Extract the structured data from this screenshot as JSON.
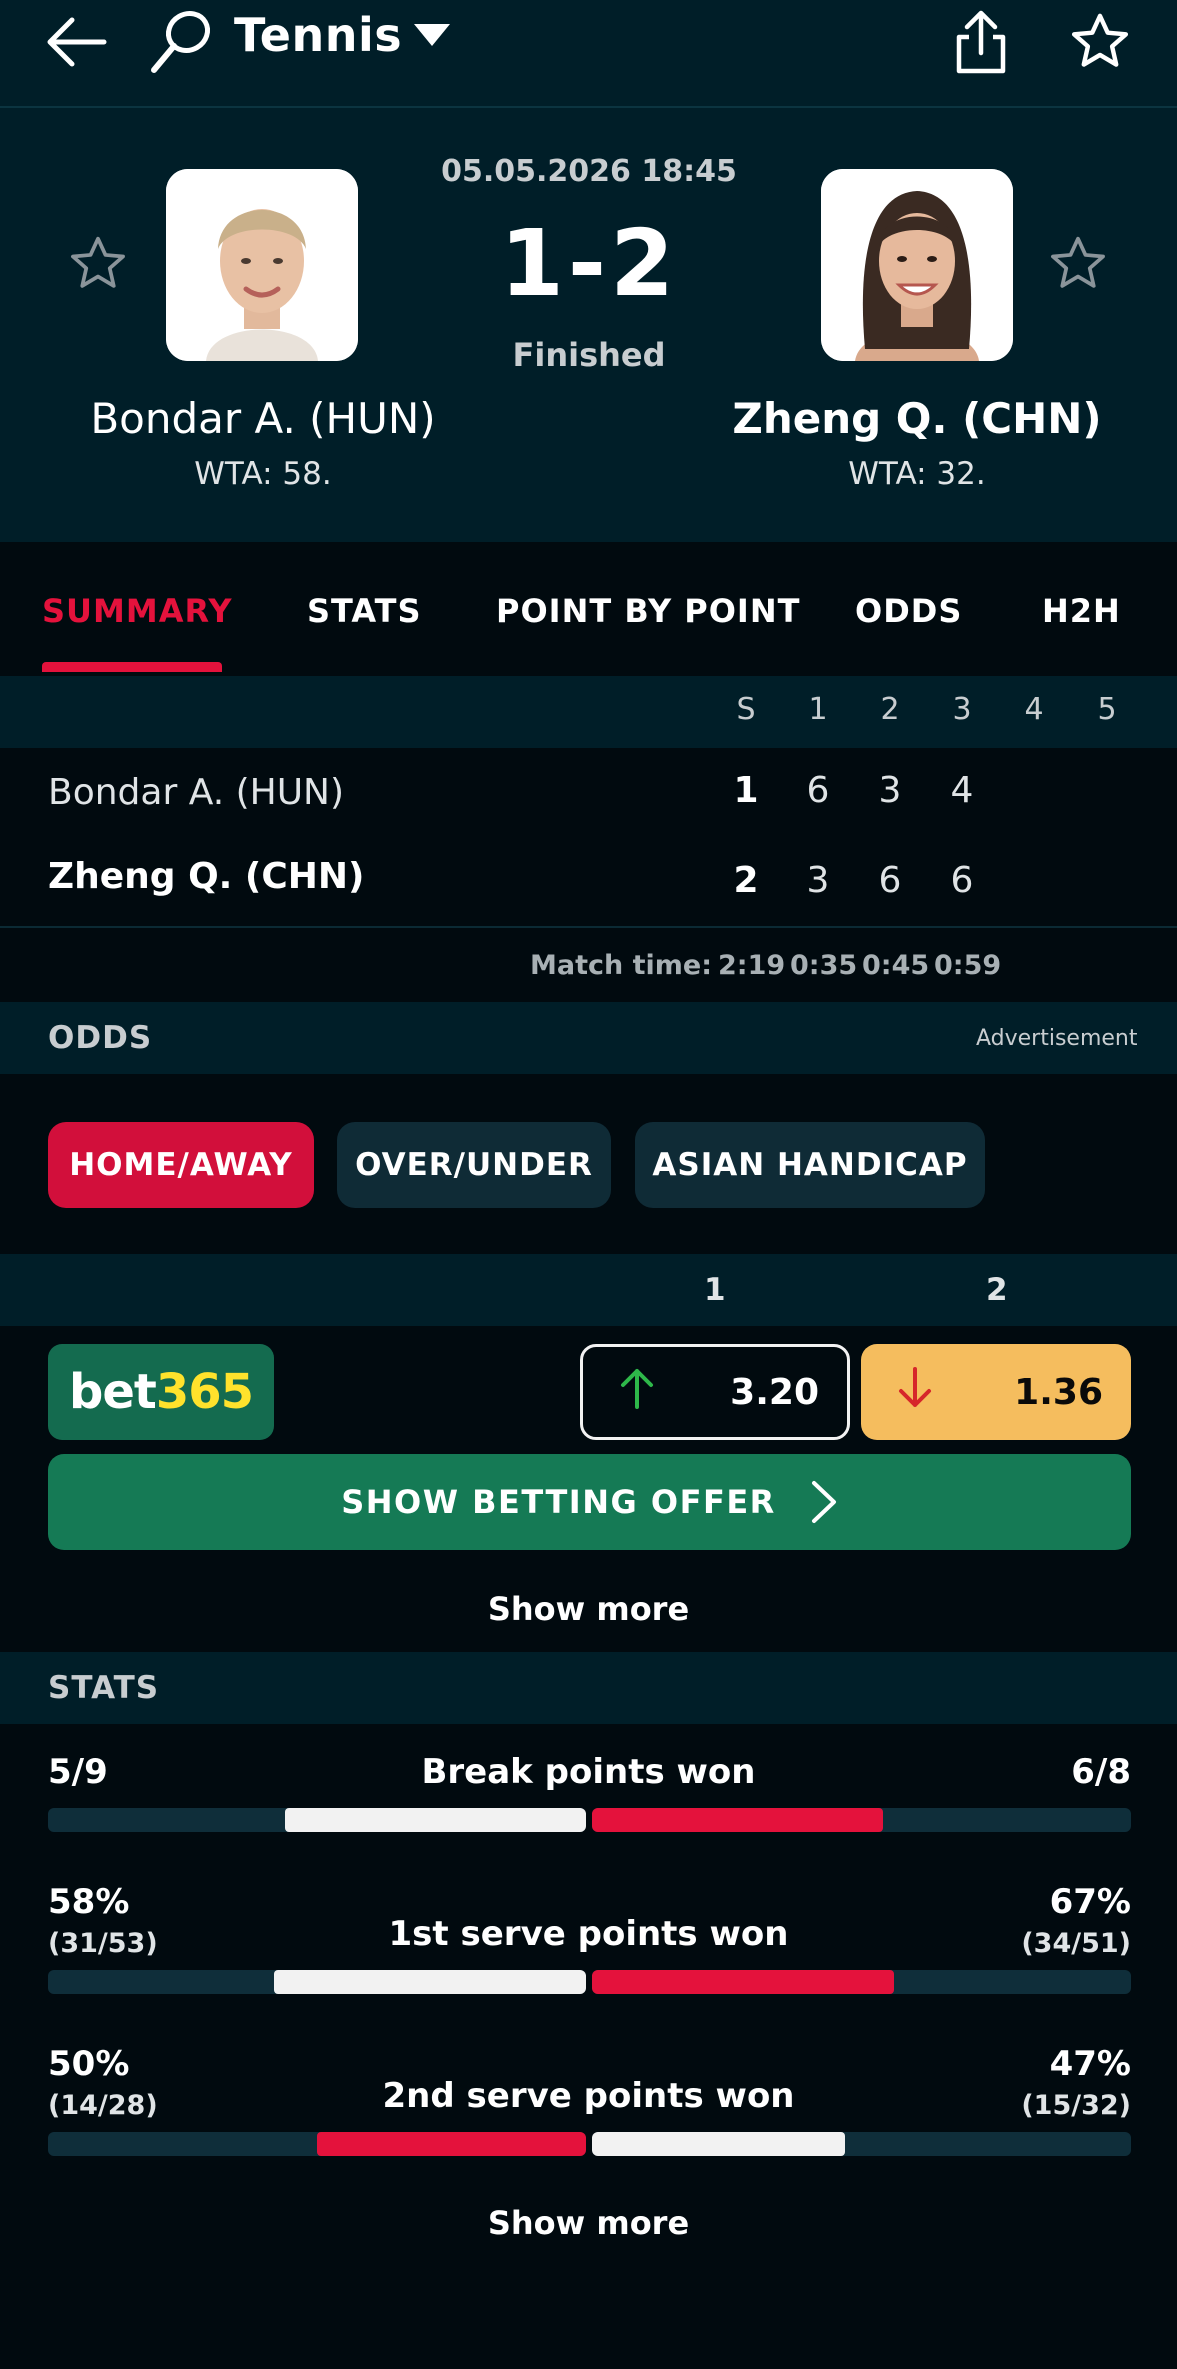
{
  "topbar": {
    "sport": "Tennis",
    "icons": [
      "back-arrow-icon",
      "tennis-racket-icon",
      "chevron-down-icon",
      "share-icon",
      "star-icon"
    ]
  },
  "match": {
    "datetime": "05.05.2026 18:45",
    "score": "1-2",
    "status": "Finished",
    "home": {
      "name": "Bondar A. (HUN)",
      "rank": "WTA: 58."
    },
    "away": {
      "name": "Zheng Q. (CHN)",
      "rank": "WTA: 32."
    }
  },
  "tabs": [
    {
      "label": "SUMMARY",
      "active": true
    },
    {
      "label": "STATS",
      "active": false
    },
    {
      "label": "POINT BY POINT",
      "active": false
    },
    {
      "label": "ODDS",
      "active": false
    },
    {
      "label": "H2H",
      "active": false
    }
  ],
  "scoreboard": {
    "columns": [
      "S",
      "1",
      "2",
      "3",
      "4",
      "5"
    ],
    "rows": [
      {
        "name": "Bondar A. (HUN)",
        "values": [
          "1",
          "6",
          "3",
          "4",
          "",
          ""
        ],
        "winner": false
      },
      {
        "name": "Zheng Q. (CHN)",
        "values": [
          "2",
          "3",
          "6",
          "6",
          "",
          ""
        ],
        "winner": true
      }
    ],
    "match_time_label": "Match time:",
    "match_times": [
      "2:19",
      "0:35",
      "0:45",
      "0:59"
    ]
  },
  "odds": {
    "title": "ODDS",
    "ad_label": "Advertisement",
    "pills": [
      {
        "label": "HOME/AWAY",
        "active": true
      },
      {
        "label": "OVER/UNDER",
        "active": false
      },
      {
        "label": "ASIAN HANDICAP",
        "active": false
      }
    ],
    "columns": [
      "1",
      "2"
    ],
    "bookmaker": {
      "part1": "bet",
      "part2": "365"
    },
    "home_odd": {
      "value": "3.20",
      "trend": "up"
    },
    "away_odd": {
      "value": "1.36",
      "trend": "down"
    },
    "betting_button": "SHOW BETTING OFFER",
    "show_more": "Show more"
  },
  "stats": {
    "title": "STATS",
    "items": [
      {
        "label": "Break points won",
        "home": "5/9",
        "away": "6/8",
        "home_sub": "",
        "away_sub": "",
        "home_frac": 0.56,
        "away_frac": 0.54,
        "home_color": "#f2f2f2",
        "away_color": "#e4123c"
      },
      {
        "label": "1st serve points won",
        "home": "58%",
        "away": "67%",
        "home_sub": "(31/53)",
        "away_sub": "(34/51)",
        "home_frac": 0.58,
        "away_frac": 0.56,
        "home_color": "#f2f2f2",
        "away_color": "#e4123c"
      },
      {
        "label": "2nd serve points won",
        "home": "50%",
        "away": "47%",
        "home_sub": "(14/28)",
        "away_sub": "(15/32)",
        "home_frac": 0.5,
        "away_frac": 0.47,
        "home_color": "#e4123c",
        "away_color": "#f2f2f2"
      }
    ],
    "show_more": "Show more"
  },
  "colors": {
    "accent": "#e4123c",
    "header_bg": "#001e28",
    "page_bg": "#010a0f",
    "bet_green": "#157a55",
    "odds_orange": "#f5bd5e"
  }
}
